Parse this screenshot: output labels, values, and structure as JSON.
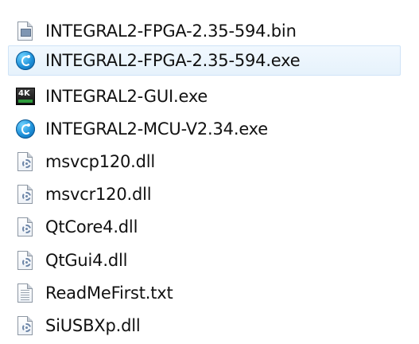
{
  "files": [
    {
      "name": "INTEGRAL2-FPGA-2.35-594.bin",
      "icon": "bin-file-icon",
      "selected": false
    },
    {
      "name": "INTEGRAL2-FPGA-2.35-594.exe",
      "icon": "blue-circle-app-icon",
      "selected": true
    },
    {
      "name": "INTEGRAL2-GUI.exe",
      "icon": "4k-app-icon",
      "selected": false
    },
    {
      "name": "INTEGRAL2-MCU-V2.34.exe",
      "icon": "blue-circle-app-icon",
      "selected": false
    },
    {
      "name": "msvcp120.dll",
      "icon": "dll-file-icon",
      "selected": false
    },
    {
      "name": "msvcr120.dll",
      "icon": "dll-file-icon",
      "selected": false
    },
    {
      "name": "QtCore4.dll",
      "icon": "dll-file-icon",
      "selected": false
    },
    {
      "name": "QtGui4.dll",
      "icon": "dll-file-icon",
      "selected": false
    },
    {
      "name": "ReadMeFirst.txt",
      "icon": "text-file-icon",
      "selected": false
    },
    {
      "name": "SiUSBXp.dll",
      "icon": "dll-file-icon",
      "selected": false
    }
  ],
  "icon_labels": {
    "4k": "4K"
  },
  "colors": {
    "selection_background": "#e6f2fc",
    "selection_border": "#cfe3f7",
    "text": "#111111",
    "app_blue": "#1d8fd8"
  }
}
